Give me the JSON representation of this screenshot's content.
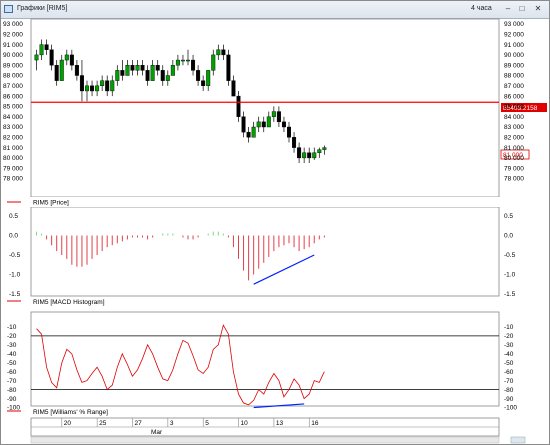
{
  "window": {
    "title": "Графики [RIM5]",
    "period": "4 часа",
    "buttons": {
      "minimize": "–",
      "maximize": "□",
      "close": "✕"
    }
  },
  "price_panel": {
    "legend": "RIM5 [Price]",
    "level_label": "85403.2158",
    "last_label": "81 000",
    "level_color": "#ff0000",
    "y_ticks": [
      93000,
      92000,
      91000,
      90000,
      89000,
      88000,
      87000,
      86000,
      85000,
      84000,
      83000,
      82000,
      81000,
      80000,
      79000,
      78000
    ],
    "y_tick_labels": [
      "93 000",
      "92 000",
      "91 000",
      "90 000",
      "89 000",
      "88 000",
      "87 000",
      "86 000",
      "85 000",
      "84 000",
      "83 000",
      "82 000",
      "81 000",
      "80 000",
      "79 000",
      "78 000"
    ]
  },
  "macd_panel": {
    "legend": "RIM5 [MACD Histogram]",
    "y_tick_labels": [
      "0.5",
      "0.0",
      "-0.5",
      "-1.0",
      "-1.5"
    ]
  },
  "williams_panel": {
    "legend": "RIM5 [Williams' % Range]",
    "y_tick_labels": [
      "-10",
      "-20",
      "-30",
      "-40",
      "-50",
      "-60",
      "-70",
      "-80",
      "-90",
      "-100"
    ]
  },
  "time_axis": {
    "day_labels": [
      "20",
      "25",
      "27",
      "3",
      "5",
      "10",
      "13",
      "16"
    ],
    "month_label": "Mar"
  },
  "colors": {
    "up": "#00a000",
    "down": "#000000",
    "macd_pos": "#7fd67f",
    "macd_neg": "#e0404a",
    "williams_line": "#e00000",
    "trendline": "#0022ff"
  },
  "chart_data": {
    "type": "candlestick",
    "candles": [
      [
        89.5,
        90.5,
        88.5,
        90.0
      ],
      [
        90.0,
        91.5,
        89.5,
        91.0
      ],
      [
        91.0,
        91.5,
        90.0,
        90.5
      ],
      [
        90.5,
        91.0,
        88.5,
        89.0
      ],
      [
        89.0,
        89.5,
        87.0,
        87.5
      ],
      [
        87.5,
        90.0,
        87.5,
        89.5
      ],
      [
        89.5,
        90.5,
        89.0,
        90.0
      ],
      [
        90.0,
        90.5,
        88.5,
        89.0
      ],
      [
        89.0,
        89.5,
        87.5,
        88.0
      ],
      [
        88.0,
        89.5,
        85.5,
        86.5
      ],
      [
        86.5,
        87.5,
        85.5,
        87.0
      ],
      [
        87.0,
        87.5,
        86.0,
        86.5
      ],
      [
        86.5,
        87.5,
        86.0,
        87.0
      ],
      [
        87.0,
        88.0,
        86.5,
        87.5
      ],
      [
        87.5,
        88.0,
        86.0,
        86.5
      ],
      [
        86.5,
        88.0,
        86.0,
        87.5
      ],
      [
        87.5,
        89.0,
        87.0,
        88.5
      ],
      [
        88.5,
        89.5,
        87.5,
        88.0
      ],
      [
        88.0,
        89.5,
        88.0,
        89.0
      ],
      [
        89.0,
        89.5,
        88.0,
        88.5
      ],
      [
        88.5,
        89.5,
        88.0,
        89.0
      ],
      [
        89.0,
        89.5,
        88.0,
        88.5
      ],
      [
        88.5,
        89.0,
        87.0,
        87.5
      ],
      [
        87.5,
        89.5,
        87.5,
        89.0
      ],
      [
        89.0,
        89.5,
        88.0,
        88.5
      ],
      [
        88.5,
        89.0,
        87.0,
        87.5
      ],
      [
        87.5,
        88.5,
        87.0,
        88.0
      ],
      [
        88.0,
        89.5,
        88.0,
        89.0
      ],
      [
        89.0,
        90.0,
        88.5,
        89.5
      ],
      [
        89.5,
        90.0,
        89.0,
        89.5
      ],
      [
        89.5,
        90.5,
        89.0,
        89.5
      ],
      [
        89.5,
        90.0,
        88.0,
        88.5
      ],
      [
        88.5,
        89.0,
        87.0,
        87.5
      ],
      [
        87.5,
        88.0,
        86.5,
        87.0
      ],
      [
        87.0,
        88.5,
        86.5,
        88.5
      ],
      [
        88.5,
        90.5,
        88.0,
        90.0
      ],
      [
        90.0,
        91.0,
        89.5,
        90.5
      ],
      [
        90.5,
        91.0,
        89.5,
        90.0
      ],
      [
        90.0,
        90.5,
        87.0,
        87.5
      ],
      [
        87.5,
        88.0,
        86.0,
        86.0
      ],
      [
        86.0,
        86.5,
        83.5,
        84.0
      ],
      [
        84.0,
        84.5,
        82.0,
        82.5
      ],
      [
        82.5,
        83.0,
        81.5,
        82.0
      ],
      [
        82.0,
        83.5,
        82.0,
        83.0
      ],
      [
        83.0,
        84.0,
        82.5,
        83.5
      ],
      [
        83.5,
        84.0,
        82.5,
        83.0
      ],
      [
        83.0,
        84.5,
        83.0,
        84.0
      ],
      [
        84.0,
        85.0,
        83.5,
        84.5
      ],
      [
        84.5,
        85.0,
        83.0,
        83.5
      ],
      [
        83.5,
        84.0,
        82.5,
        83.0
      ],
      [
        83.0,
        83.5,
        81.5,
        82.0
      ],
      [
        82.0,
        82.5,
        80.5,
        81.0
      ],
      [
        81.0,
        81.5,
        79.5,
        80.0
      ],
      [
        80.0,
        81.0,
        79.5,
        80.5
      ],
      [
        80.5,
        81.0,
        79.5,
        80.0
      ],
      [
        80.0,
        81.0,
        79.8,
        80.5
      ],
      [
        80.5,
        81.0,
        80.0,
        80.8
      ],
      [
        80.8,
        81.2,
        80.3,
        81.0
      ]
    ],
    "level": 85403.2158,
    "macd": [
      0.1,
      0.05,
      -0.1,
      -0.25,
      -0.4,
      -0.5,
      -0.6,
      -0.75,
      -0.8,
      -0.8,
      -0.75,
      -0.6,
      -0.5,
      -0.4,
      -0.3,
      -0.25,
      -0.2,
      -0.15,
      -0.1,
      -0.05,
      -0.05,
      -0.05,
      -0.1,
      -0.05,
      0.0,
      0.05,
      0.05,
      0.05,
      0.0,
      -0.05,
      -0.1,
      -0.1,
      -0.05,
      0.0,
      0.05,
      0.1,
      0.1,
      0.05,
      -0.05,
      -0.3,
      -0.6,
      -0.9,
      -1.15,
      -1.0,
      -0.85,
      -0.7,
      -0.55,
      -0.4,
      -0.3,
      -0.25,
      -0.2,
      -0.3,
      -0.4,
      -0.35,
      -0.3,
      -0.2,
      -0.1,
      -0.05
    ],
    "williams": [
      -12,
      -18,
      -55,
      -72,
      -78,
      -50,
      -35,
      -40,
      -58,
      -72,
      -70,
      -62,
      -55,
      -65,
      -80,
      -75,
      -55,
      -40,
      -52,
      -65,
      -58,
      -45,
      -30,
      -40,
      -55,
      -68,
      -70,
      -58,
      -40,
      -25,
      -28,
      -42,
      -58,
      -62,
      -55,
      -35,
      -30,
      -8,
      -18,
      -60,
      -85,
      -95,
      -97,
      -92,
      -80,
      -85,
      -72,
      -62,
      -70,
      -88,
      -80,
      -68,
      -75,
      -90,
      -85,
      -70,
      -72,
      -60
    ],
    "williams_levels": [
      -20,
      -80
    ]
  }
}
